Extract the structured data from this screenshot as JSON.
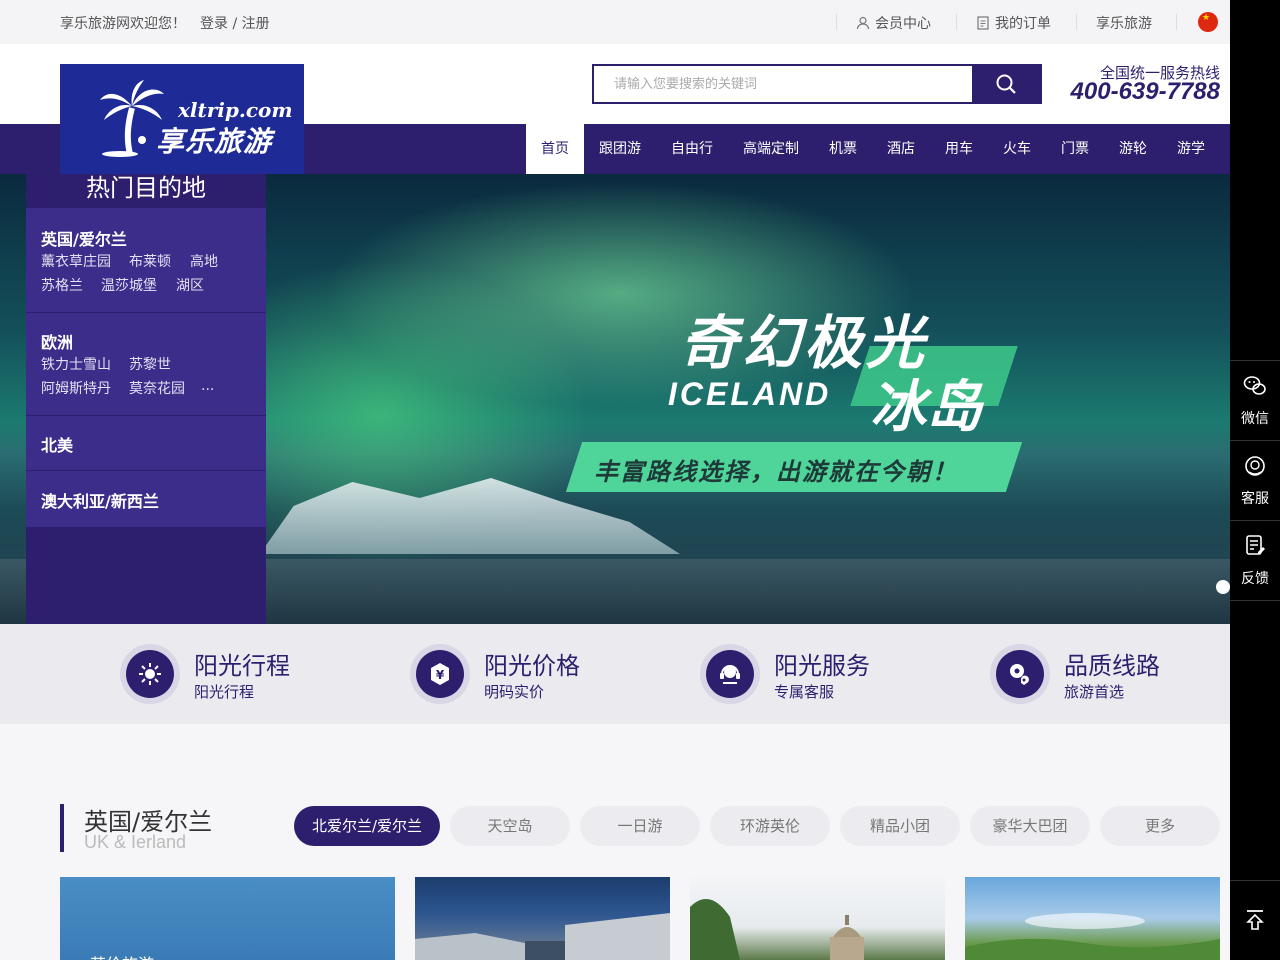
{
  "topbar": {
    "welcome": "享乐旅游网欢迎您！",
    "login": "登录 / 注册",
    "member": "会员中心",
    "orders": "我的订单",
    "brand": "享乐旅游"
  },
  "logo": {
    "url": "xltrip.com",
    "name": "享乐旅游"
  },
  "search": {
    "placeholder": "请输入您要搜索的关键词"
  },
  "hotline": {
    "label": "全国统一服务热线",
    "number": "400-639-7788"
  },
  "nav": [
    "首页",
    "跟团游",
    "自由行",
    "高端定制",
    "机票",
    "酒店",
    "用车",
    "火车",
    "门票",
    "游轮",
    "游学"
  ],
  "banner": {
    "line1": "奇幻极光",
    "line2": "ICELAND",
    "line3": "冰岛",
    "line4": "丰富路线选择，出游就在今朝！"
  },
  "destinations": {
    "title": "热门目的地",
    "groups": [
      {
        "name": "英国/爱尔兰",
        "items": [
          "薰衣草庄园",
          "布莱顿",
          "高地",
          "苏格兰",
          "温莎城堡",
          "湖区"
        ]
      },
      {
        "name": "欧洲",
        "items": [
          "铁力士雪山",
          "苏黎世",
          "阿姆斯特丹",
          "莫奈花园",
          "..."
        ]
      },
      {
        "name": "北美",
        "items": []
      },
      {
        "name": "澳大利亚/新西兰",
        "items": []
      }
    ]
  },
  "features": [
    {
      "title": "阳光行程",
      "sub": "阳光行程",
      "icon": "sun-icon"
    },
    {
      "title": "阳光价格",
      "sub": "明码实价",
      "icon": "yen-icon"
    },
    {
      "title": "阳光服务",
      "sub": "专属客服",
      "icon": "headset-icon"
    },
    {
      "title": "品质线路",
      "sub": "旅游首选",
      "icon": "route-icon"
    }
  ],
  "section": {
    "title": "英国/爱尔兰",
    "subtitle": "UK & Ierland",
    "tabs": [
      "北爱尔兰/爱尔兰",
      "天空岛",
      "一日游",
      "环游英伦",
      "精品小团",
      "豪华大巴团",
      "更多"
    ],
    "card1_label": "英伦旅游"
  },
  "rightbar": {
    "wechat": "微信",
    "service": "客服",
    "feedback": "反馈"
  },
  "colors": {
    "brand": "#2d1f6e",
    "nav_active_bg": "#ffffff",
    "logo_bg": "#1e2a95"
  }
}
